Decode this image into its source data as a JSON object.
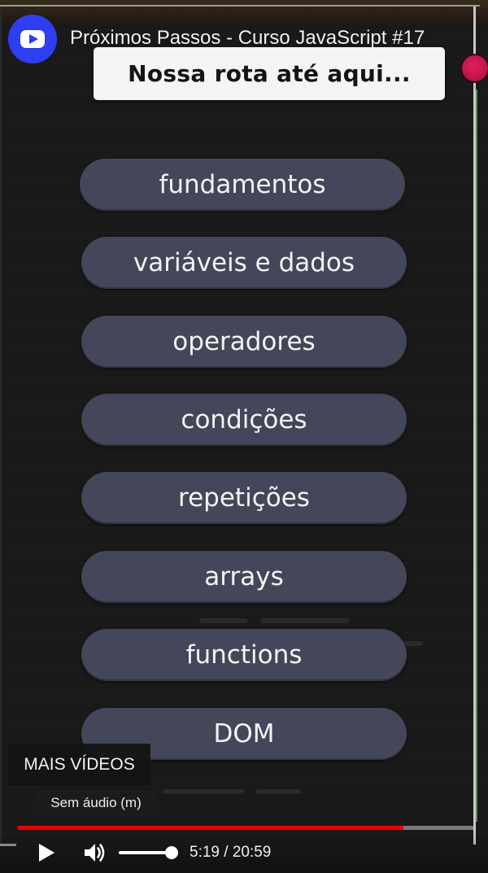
{
  "player": {
    "channel_icon": "youtube-play-icon",
    "video_title": "Próximos Passos - Curso JavaScript #17",
    "more_videos_label": "MAIS VÍDEOS",
    "mute_tooltip": "Sem áudio (m)",
    "time_display": "5:19 / 20:59",
    "progress_fraction": 0.846,
    "volume_fraction": 0.9,
    "accent_color": "#ee0000",
    "play_icon": "play-icon",
    "volume_icon": "volume-icon"
  },
  "slide": {
    "headline": "Nossa rota até aqui...",
    "topics": [
      "fundamentos",
      "variáveis e dados",
      "operadores",
      "condições",
      "repetições",
      "arrays",
      "functions",
      "DOM"
    ],
    "pill_color": "#444759",
    "record_dot_color": "#d0185a"
  }
}
